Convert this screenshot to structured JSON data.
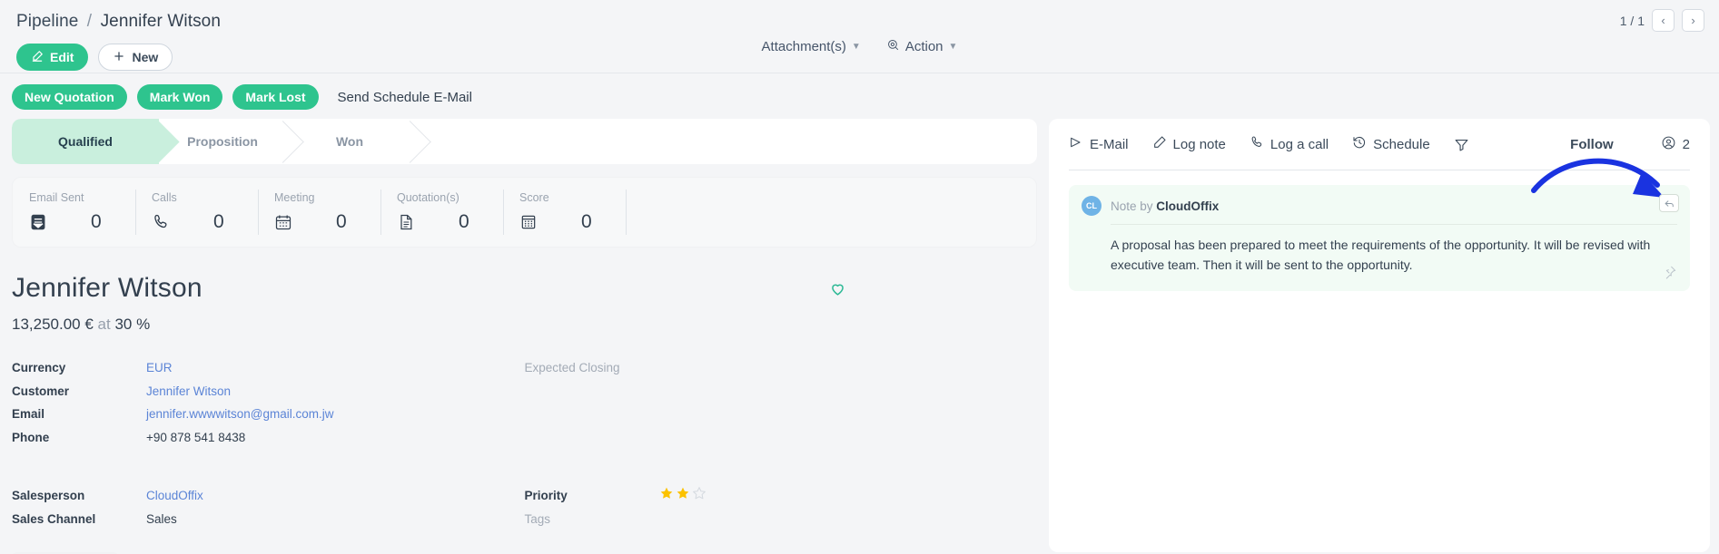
{
  "header": {
    "breadcrumb_root": "Pipeline",
    "breadcrumb_sep": "/",
    "breadcrumb_current": "Jennifer Witson",
    "edit_label": "Edit",
    "new_label": "New",
    "attachments_label": "Attachment(s)",
    "action_label": "Action",
    "pager_text": "1 / 1",
    "pager_prev": "‹",
    "pager_next": "›"
  },
  "chips": {
    "new_quotation": "New Quotation",
    "mark_won": "Mark Won",
    "mark_lost": "Mark Lost",
    "send_schedule_email": "Send Schedule E-Mail"
  },
  "stages": [
    {
      "label": "Qualified",
      "state": "done"
    },
    {
      "label": "Proposition",
      "state": "todo"
    },
    {
      "label": "Won",
      "state": "todo"
    }
  ],
  "stats": [
    {
      "label": "Email Sent",
      "value": "0",
      "icon": "inbox-icon"
    },
    {
      "label": "Calls",
      "value": "0",
      "icon": "phone-icon"
    },
    {
      "label": "Meeting",
      "value": "0",
      "icon": "calendar-icon"
    },
    {
      "label": "Quotation(s)",
      "value": "0",
      "icon": "document-icon"
    },
    {
      "label": "Score",
      "value": "0",
      "icon": "calculator-icon"
    }
  ],
  "record": {
    "title": "Jennifer Witson",
    "amount": "13,250.00 €",
    "at_word": "at",
    "probability": "30 %"
  },
  "fields_left": [
    {
      "label": "Currency",
      "value": "EUR",
      "link": true
    },
    {
      "label": "Customer",
      "value": "Jennifer Witson",
      "link": true
    },
    {
      "label": "Email",
      "value": "jennifer.wwwwitson@gmail.com.jw",
      "link": true
    },
    {
      "label": "Phone",
      "value": "+90 878 541 8438",
      "link": false
    }
  ],
  "fields_left2": [
    {
      "label": "Salesperson",
      "value": "CloudOffix",
      "link": true
    },
    {
      "label": "Sales Channel",
      "value": "Sales",
      "link": false
    }
  ],
  "fields_right": [
    {
      "label": "Expected Closing",
      "value": "",
      "muted": true
    }
  ],
  "fields_right2": [
    {
      "label": "Priority",
      "value": "",
      "muted": false,
      "stars_filled": 2,
      "stars_total": 3
    },
    {
      "label": "Tags",
      "value": "",
      "muted": true
    }
  ],
  "chatter": {
    "email_label": "E-Mail",
    "log_note_label": "Log note",
    "log_call_label": "Log a call",
    "schedule_label": "Schedule",
    "filter_icon": "filter-icon",
    "follow_label": "Follow",
    "followers_count": "2",
    "note": {
      "by_prefix": "Note by",
      "author": "CloudOffix",
      "avatar_initials": "CL",
      "body": "A proposal has been prepared to meet the requirements of the opportunity. It will be revised with executive team. Then it will be sent to the opportunity."
    }
  },
  "colors": {
    "accent_green": "#2ec48e",
    "stage_done": "#c9efdd",
    "link_blue": "#5b84d6",
    "annotation_blue": "#1a33e0",
    "note_bg": "#f2fbf5",
    "star_gold": "#fcc200"
  }
}
